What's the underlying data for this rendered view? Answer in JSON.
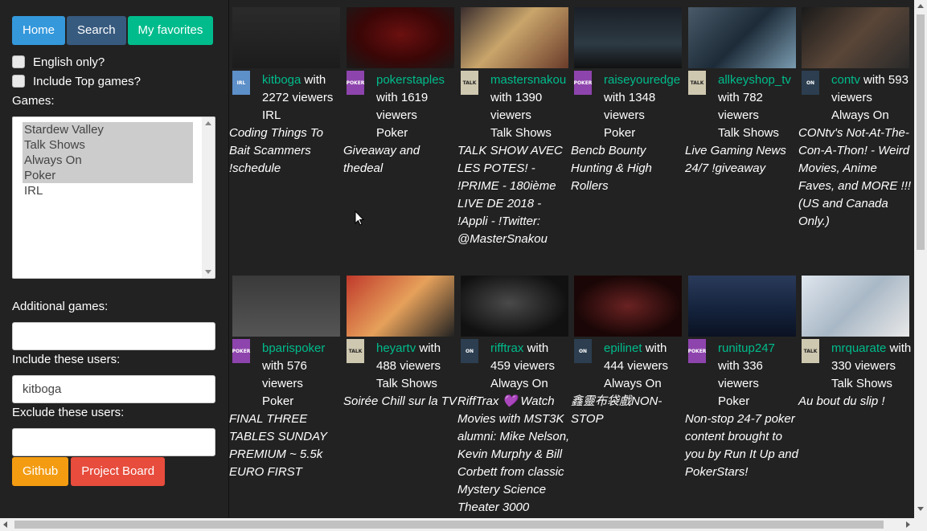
{
  "nav": {
    "home_label": "Home",
    "search_label": "Search",
    "favorites_label": "My favorites"
  },
  "filters": {
    "english_only_label": "English only?",
    "english_only_checked": false,
    "include_top_label": "Include Top games?",
    "include_top_checked": false,
    "games_label": "Games:",
    "games_options": [
      {
        "label": "Stardew Valley",
        "selected": true
      },
      {
        "label": "Talk Shows",
        "selected": true
      },
      {
        "label": "Always On",
        "selected": true
      },
      {
        "label": "Poker",
        "selected": true
      },
      {
        "label": "IRL",
        "selected": false
      }
    ],
    "additional_games_label": "Additional games:",
    "additional_games_value": "",
    "include_users_label": "Include these users:",
    "include_users_value": "kitboga",
    "exclude_users_label": "Exclude these users:",
    "exclude_users_value": ""
  },
  "footer": {
    "github_label": "Github",
    "board_label": "Project Board"
  },
  "colors": {
    "accent_green": "#00bc8c",
    "accent_blue": "#3498db",
    "accent_orange": "#f39c12",
    "accent_red": "#e74c3c"
  },
  "streams": [
    {
      "user": "kitboga",
      "with": "with",
      "viewers": "2272",
      "viewers_label": "viewers",
      "game": "IRL",
      "title": "Coding Things To Bait Scammers !schedule",
      "avatar": "irl"
    },
    {
      "user": "pokerstaples",
      "with": "with",
      "viewers": "1619",
      "viewers_label": "viewers",
      "game": "Poker",
      "title": "Giveaway and thedeal",
      "avatar": "poker"
    },
    {
      "user": "mastersnakou",
      "with": "with",
      "viewers": "1390",
      "viewers_label": "viewers",
      "game": "Talk Shows",
      "title": "TALK SHOW AVEC LES POTES! - !PRIME - 180ième LIVE DE 2018 - !Appli - !Twitter: @MasterSnakou",
      "avatar": "talk"
    },
    {
      "user": "raiseyouredge",
      "with": "with",
      "viewers": "1348",
      "viewers_label": "viewers",
      "game": "Poker",
      "title": "Bencb Bounty Hunting & High Rollers",
      "avatar": "poker"
    },
    {
      "user": "allkeyshop_tv",
      "with": "with",
      "viewers": "782",
      "viewers_label": "viewers",
      "game": "Talk Shows",
      "title": "Live Gaming News 24/7 !giveaway",
      "avatar": "talk"
    },
    {
      "user": "contv",
      "with": "with",
      "viewers": "593",
      "viewers_label": "viewers",
      "game": "Always On",
      "title": "CONtv's Not-At-The-Con-A-Thon! - Weird Movies, Anime Faves, and MORE !!! (US and Canada Only.)",
      "avatar": "always"
    },
    {
      "user": "bparispoker",
      "with": "with",
      "viewers": "576",
      "viewers_label": "viewers",
      "game": "Poker",
      "title": "FINAL THREE TABLES SUNDAY PREMIUM ~ 5.5k EURO FIRST",
      "avatar": "poker"
    },
    {
      "user": "heyartv",
      "with": "with",
      "viewers": "488",
      "viewers_label": "viewers",
      "game": "Talk Shows",
      "title": "Soirée Chill sur la TV",
      "avatar": "talk"
    },
    {
      "user": "rifftrax",
      "with": "with",
      "viewers": "459",
      "viewers_label": "viewers",
      "game": "Always On",
      "title": "RiffTrax 💜 Watch Movies with MST3K alumni: Mike Nelson, Kevin Murphy & Bill Corbett from classic Mystery Science Theater 3000",
      "avatar": "always"
    },
    {
      "user": "epilinet",
      "with": "with",
      "viewers": "444",
      "viewers_label": "viewers",
      "game": "Always On",
      "title": "鑫靈布袋戲NON-STOP",
      "avatar": "always"
    },
    {
      "user": "runitup247",
      "with": "with",
      "viewers": "336",
      "viewers_label": "viewers",
      "game": "Poker",
      "title": "Non-stop 24-7 poker content brought to you by Run It Up and PokerStars!",
      "avatar": "poker"
    },
    {
      "user": "mrquarate",
      "with": "with",
      "viewers": "330",
      "viewers_label": "viewers",
      "game": "Talk Shows",
      "title": "Au bout du slip !",
      "avatar": "talk"
    }
  ]
}
